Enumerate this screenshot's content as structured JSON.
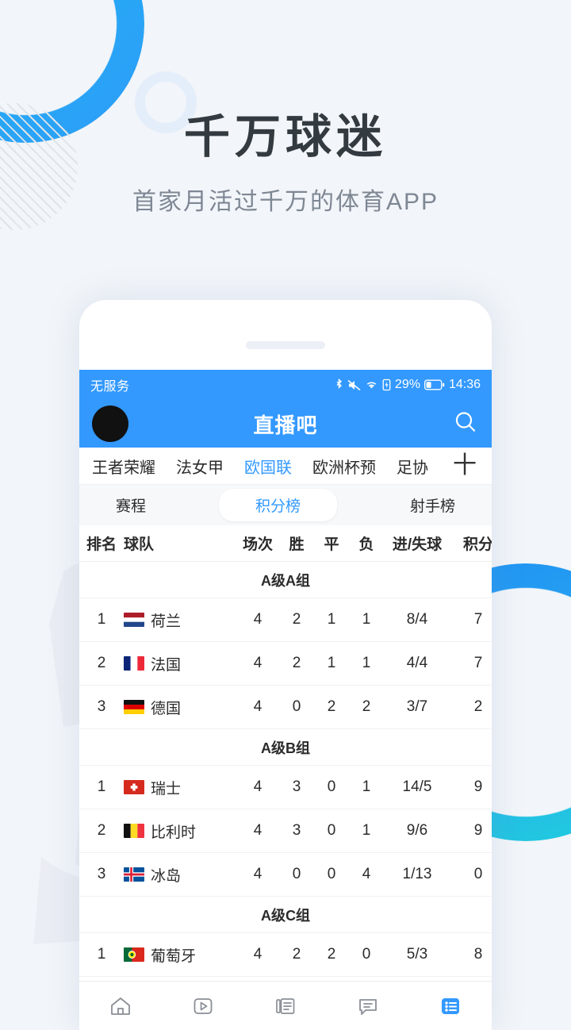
{
  "hero": {
    "title": "千万球迷",
    "subtitle": "首家月活过千万的体育APP"
  },
  "colors": {
    "brand_blue": "#3399ff",
    "page_bg": "#f2f5f9",
    "text_dark": "#2b2b2b",
    "text_muted": "#7e8794"
  },
  "phone": {
    "statusbar": {
      "carrier": "无服务",
      "battery_percent": "29%",
      "time": "14:36",
      "icons": [
        "bluetooth-icon",
        "mute-icon",
        "wifi-icon",
        "battery-saver-icon",
        "battery-icon"
      ]
    },
    "appbar": {
      "title": "直播吧",
      "avatar": "avatar",
      "search": "search-icon"
    },
    "categories": [
      {
        "label": "王者荣耀",
        "active": false
      },
      {
        "label": "法女甲",
        "active": false
      },
      {
        "label": "欧国联",
        "active": true
      },
      {
        "label": "欧洲杯预",
        "active": false
      },
      {
        "label": "足协",
        "active": false
      }
    ],
    "add_category_label": "十",
    "subtabs": [
      {
        "label": "赛程",
        "active": false
      },
      {
        "label": "积分榜",
        "active": true
      },
      {
        "label": "射手榜",
        "active": false
      }
    ],
    "table": {
      "headers": {
        "rank": "排名",
        "team": "球队",
        "played": "场次",
        "win": "胜",
        "draw": "平",
        "lose": "负",
        "goals": "进/失球",
        "points": "积分"
      },
      "groups": [
        {
          "name": "A级A组",
          "rows": [
            {
              "rank": "1",
              "team": "荷兰",
              "flag": "flag-netherlands",
              "played": "4",
              "win": "2",
              "draw": "1",
              "lose": "1",
              "goals": "8/4",
              "points": "7"
            },
            {
              "rank": "2",
              "team": "法国",
              "flag": "flag-france",
              "played": "4",
              "win": "2",
              "draw": "1",
              "lose": "1",
              "goals": "4/4",
              "points": "7"
            },
            {
              "rank": "3",
              "team": "德国",
              "flag": "flag-germany",
              "played": "4",
              "win": "0",
              "draw": "2",
              "lose": "2",
              "goals": "3/7",
              "points": "2"
            }
          ]
        },
        {
          "name": "A级B组",
          "rows": [
            {
              "rank": "1",
              "team": "瑞士",
              "flag": "flag-switzerland",
              "played": "4",
              "win": "3",
              "draw": "0",
              "lose": "1",
              "goals": "14/5",
              "points": "9"
            },
            {
              "rank": "2",
              "team": "比利时",
              "flag": "flag-belgium",
              "played": "4",
              "win": "3",
              "draw": "0",
              "lose": "1",
              "goals": "9/6",
              "points": "9"
            },
            {
              "rank": "3",
              "team": "冰岛",
              "flag": "flag-iceland",
              "played": "4",
              "win": "0",
              "draw": "0",
              "lose": "4",
              "goals": "1/13",
              "points": "0"
            }
          ]
        },
        {
          "name": "A级C组",
          "rows": [
            {
              "rank": "1",
              "team": "葡萄牙",
              "flag": "flag-portugal",
              "played": "4",
              "win": "2",
              "draw": "2",
              "lose": "0",
              "goals": "5/3",
              "points": "8"
            }
          ]
        }
      ]
    },
    "bottomnav": [
      {
        "icon": "home-icon",
        "active": false
      },
      {
        "icon": "video-icon",
        "active": false
      },
      {
        "icon": "news-icon",
        "active": false
      },
      {
        "icon": "chat-icon",
        "active": false
      },
      {
        "icon": "list-icon",
        "active": true
      }
    ]
  }
}
